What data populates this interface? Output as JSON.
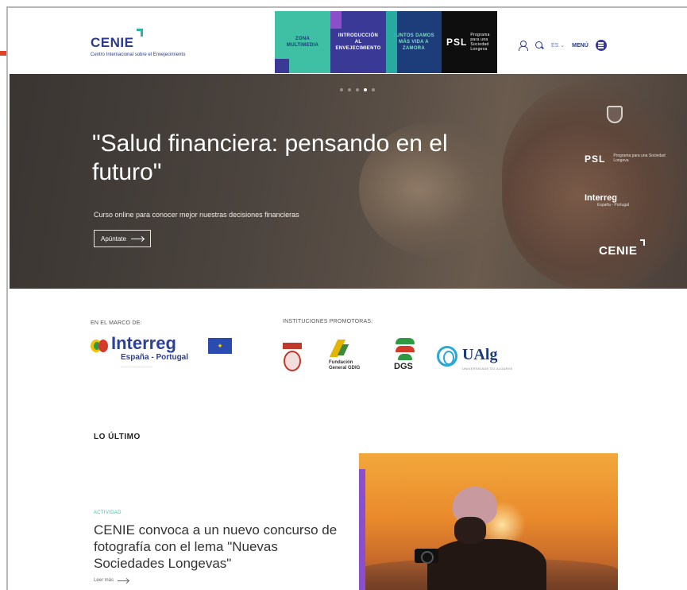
{
  "header": {
    "logo": {
      "word": "CENIE",
      "subtitle": "Centro Internacional sobre el Envejecimiento"
    },
    "tiles": [
      {
        "label": "ZONA MULTIMEDIA"
      },
      {
        "label": "INTRODUCCIÓN AL ENVEJECIMIENTO"
      },
      {
        "label": "JUNTOS DAMOS MÁS VIDA A ZAMORA"
      },
      {
        "label": "PSL",
        "sub": "Programa para una Sociedad Longeva"
      }
    ],
    "language": "ES",
    "menu_label": "MENÚ"
  },
  "hero": {
    "title": "\"Salud financiera: pensando en el futuro\"",
    "subtitle": "Curso online para conocer mejor nuestras decisiones financieras",
    "button_label": "Apúntate",
    "slides_total": 5,
    "slide_active": 4,
    "logos": {
      "psl": "PSL",
      "psl_sub": "Programa para una Sociedad Longeva",
      "interreg": "Interreg",
      "interreg_sub": "España - Portugal",
      "cenie": "CENIE"
    }
  },
  "partners": {
    "framework_label": "EN EL MARCO DE:",
    "promoters_label": "INSTITUCIONES PROMOTORAS:",
    "interreg": {
      "name": "Interreg",
      "region": "España - Portugal"
    },
    "fgdig": "Fundación General GDIG",
    "dgs": "DGS",
    "ualg": {
      "name": "UAlg",
      "sub": "UNIVERSIDADE DO ALGARVE"
    }
  },
  "latest": {
    "section_title": "LO ÚLTIMO",
    "tag": "ACTIVIDAD",
    "title": "CENIE convoca a un nuevo concurso de fotografía con el lema \"Nuevas Sociedades Longevas\"",
    "more_label": "Leer más"
  },
  "colors": {
    "brand_blue": "#2b3a8c",
    "teal": "#3fbfa3",
    "purple": "#8b4fc9",
    "indigo": "#3a3a96"
  }
}
